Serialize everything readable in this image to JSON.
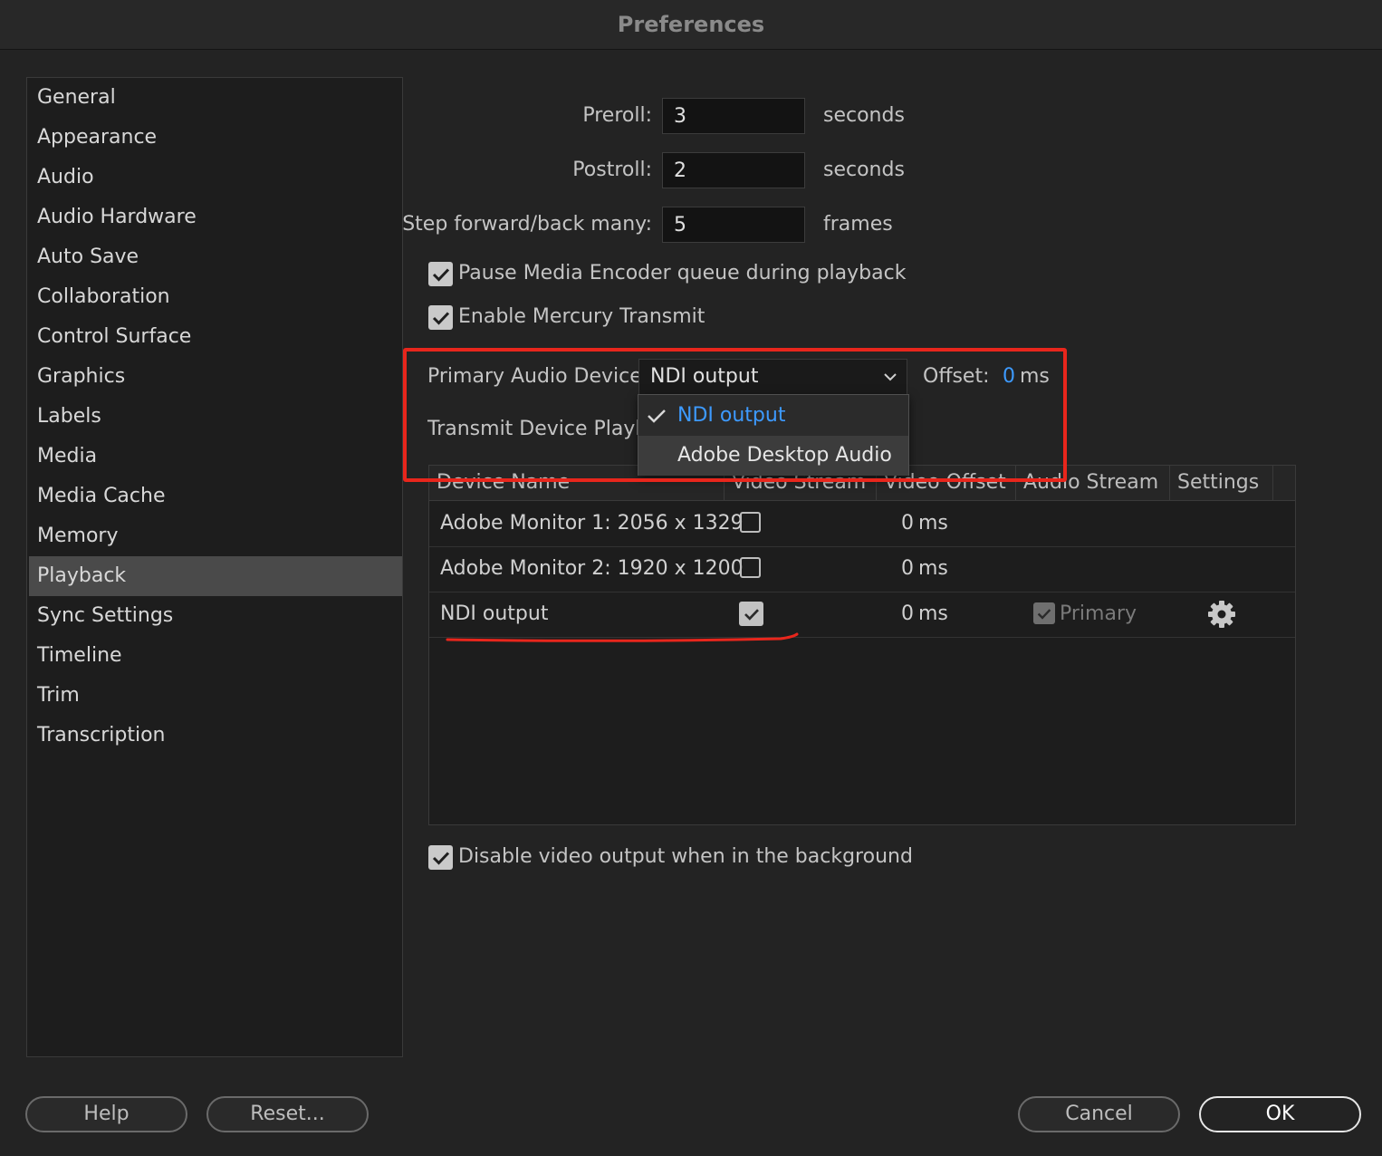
{
  "window": {
    "title": "Preferences"
  },
  "sidebar": {
    "items": [
      {
        "label": "General"
      },
      {
        "label": "Appearance"
      },
      {
        "label": "Audio"
      },
      {
        "label": "Audio Hardware"
      },
      {
        "label": "Auto Save"
      },
      {
        "label": "Collaboration"
      },
      {
        "label": "Control Surface"
      },
      {
        "label": "Graphics"
      },
      {
        "label": "Labels"
      },
      {
        "label": "Media"
      },
      {
        "label": "Media Cache"
      },
      {
        "label": "Memory"
      },
      {
        "label": "Playback"
      },
      {
        "label": "Sync Settings"
      },
      {
        "label": "Timeline"
      },
      {
        "label": "Trim"
      },
      {
        "label": "Transcription"
      }
    ],
    "selected": "Playback"
  },
  "playback": {
    "preroll": {
      "label": "Preroll:",
      "value": "3",
      "unit": "seconds"
    },
    "postroll": {
      "label": "Postroll:",
      "value": "2",
      "unit": "seconds"
    },
    "step": {
      "label": "Step forward/back many:",
      "value": "5",
      "unit": "frames"
    },
    "pause_encoder": {
      "label": "Pause Media Encoder queue during playback",
      "checked": true
    },
    "mercury": {
      "label": "Enable Mercury Transmit",
      "checked": true
    },
    "primary_audio": {
      "label": "Primary Audio Device:",
      "selected": "NDI output",
      "offset_label": "Offset:",
      "offset_value": "0",
      "offset_unit": "ms"
    },
    "dropdown_options": [
      {
        "label": "NDI output",
        "checked": true
      },
      {
        "label": "Adobe Desktop Audio",
        "checked": false
      }
    ],
    "transmit_label": "Transmit Device Playbac",
    "table": {
      "headers": [
        "Device Name",
        "Video Stream",
        "Video Offset",
        "Audio Stream",
        "Settings"
      ],
      "rows": [
        {
          "name": "Adobe Monitor 1: 2056 x 1329",
          "video": false,
          "offset": "0",
          "unit": "ms"
        },
        {
          "name": "Adobe Monitor 2: 1920 x 1200",
          "video": false,
          "offset": "0",
          "unit": "ms"
        },
        {
          "name": "NDI output",
          "video": true,
          "offset": "0",
          "unit": "ms",
          "audio_label": "Primary",
          "audio": true
        }
      ]
    },
    "disable_bg": {
      "label": "Disable video output when in the background",
      "checked": true
    }
  },
  "buttons": {
    "help": "Help",
    "reset": "Reset...",
    "cancel": "Cancel",
    "ok": "OK"
  },
  "colors": {
    "accent": "#3d9aff",
    "annotation": "#e8261c",
    "background": "#232323"
  }
}
